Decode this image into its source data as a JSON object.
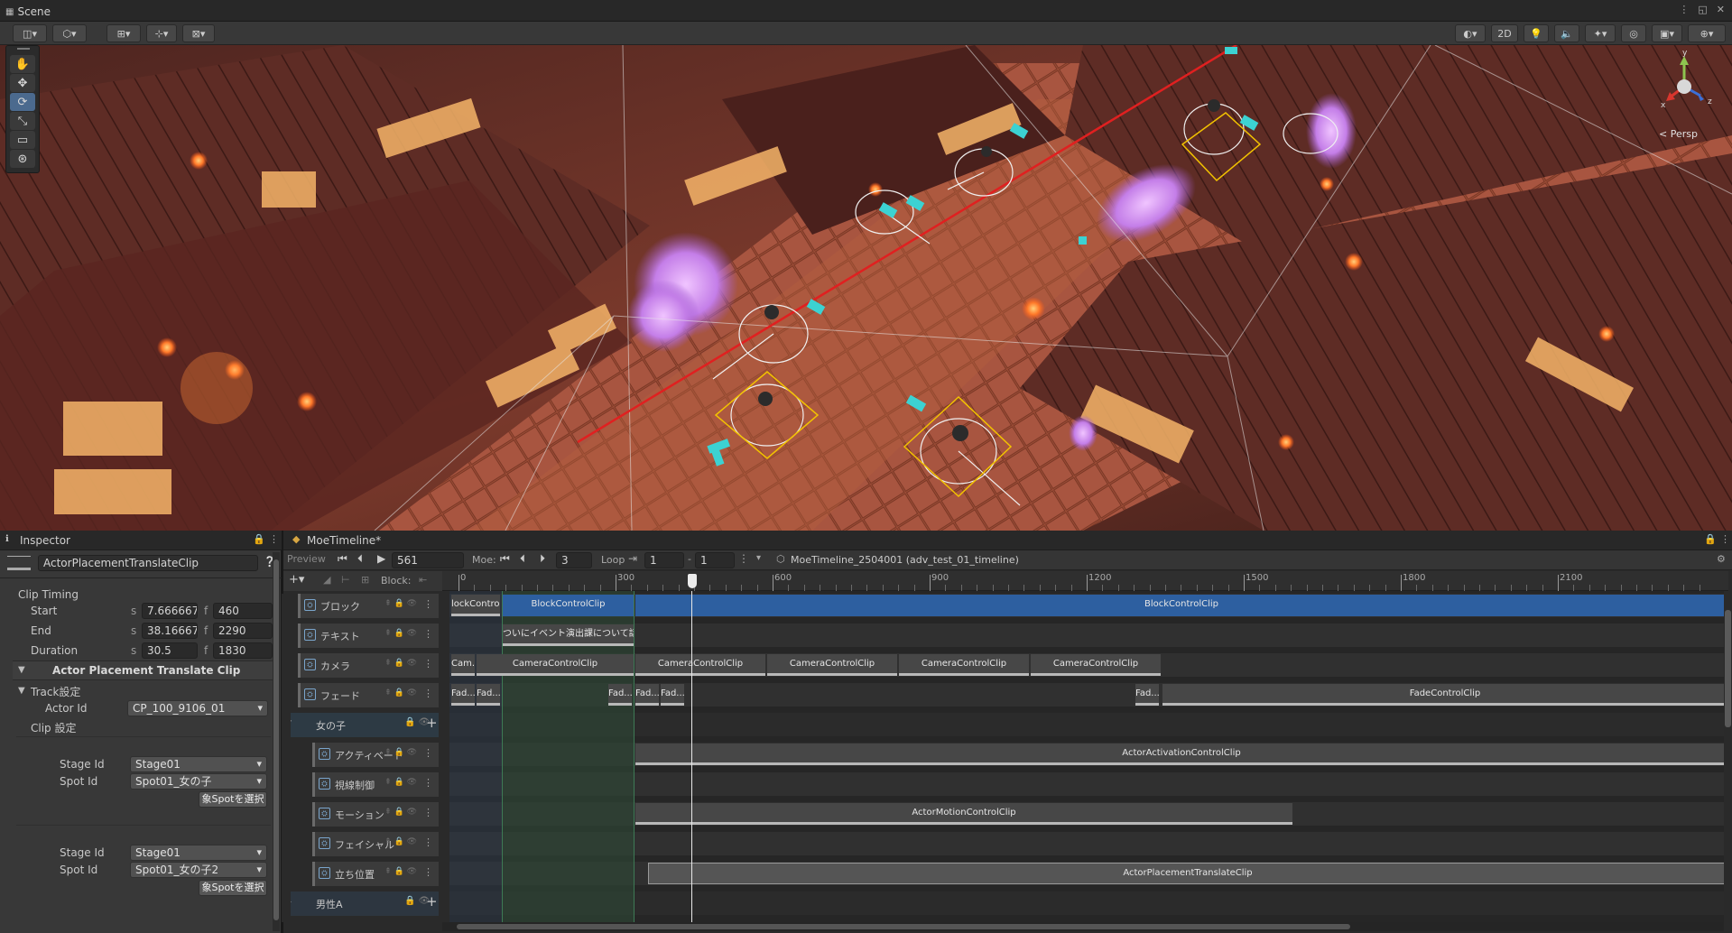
{
  "scene": {
    "tab_label": "Scene",
    "btn_2d": "2D",
    "persp_label": "Persp",
    "gizmo_axes": {
      "x": "x",
      "y": "y",
      "z": "z"
    }
  },
  "inspector": {
    "tab_label": "Inspector",
    "object_name": "ActorPlacementTranslateClip",
    "clip_timing": "Clip Timing",
    "rows": [
      {
        "label": "Start",
        "s": "7.666667",
        "f": "460"
      },
      {
        "label": "End",
        "s": "38.16667",
        "f": "2290"
      },
      {
        "label": "Duration",
        "s": "30.5",
        "f": "1830"
      }
    ],
    "s_prefix": "s",
    "f_prefix": "f",
    "component_title": "Actor Placement Translate Clip",
    "track_settings": "Track設定",
    "actor_id_label": "Actor Id",
    "actor_id_value": "CP_100_9106_01",
    "clip_settings": "Clip 設定",
    "groups": [
      {
        "stage_label": "Stage Id",
        "stage_value": "Stage01",
        "spot_label": "Spot Id",
        "spot_value": "Spot01_女の子",
        "button": "象Spotを選択"
      },
      {
        "stage_label": "Stage Id",
        "stage_value": "Stage01",
        "spot_label": "Spot Id",
        "spot_value": "Spot01_女の子2",
        "button": "象Spotを選択"
      }
    ]
  },
  "timeline": {
    "tab_label": "MoeTimeline*",
    "preview": "Preview",
    "frame_value": "561",
    "moe_label": "Moe:",
    "moe_value": "3",
    "loop_label": "Loop",
    "loop_from": "1",
    "loop_to": "1",
    "asset_name": "MoeTimeline_2504001 (adv_test_01_timeline)",
    "block_label": "Block:",
    "ruler": [
      "0",
      "300",
      "600",
      "900",
      "1200",
      "1500",
      "1800",
      "2100"
    ],
    "tracks": [
      {
        "name": "ブロック"
      },
      {
        "name": "テキスト"
      },
      {
        "name": "カメラ"
      },
      {
        "name": "フェード"
      },
      {
        "name": "女の子",
        "group": true
      },
      {
        "name": "アクティベート"
      },
      {
        "name": "視線制御"
      },
      {
        "name": "モーション"
      },
      {
        "name": "フェイシャル"
      },
      {
        "name": "立ち位置"
      },
      {
        "name": "男性A",
        "group": true
      }
    ],
    "clips": {
      "block": [
        "lockContro...",
        "BlockControlClip",
        "BlockControlClip"
      ],
      "text": [
        "ついにイベント演出課について話す時が来たか"
      ],
      "camera": [
        "Cam...",
        "CameraControlClip",
        "CameraControlClip",
        "CameraControlClip",
        "CameraControlClip",
        "CameraControlClip"
      ],
      "fade": [
        "Fad...",
        "Fad...",
        "Fad...",
        "Fad...",
        "Fad...",
        "Fad...",
        "FadeControlClip"
      ],
      "activation": "ActorActivationControlClip",
      "motion": "ActorMotionControlClip",
      "placement": "ActorPlacementTranslateClip"
    }
  }
}
